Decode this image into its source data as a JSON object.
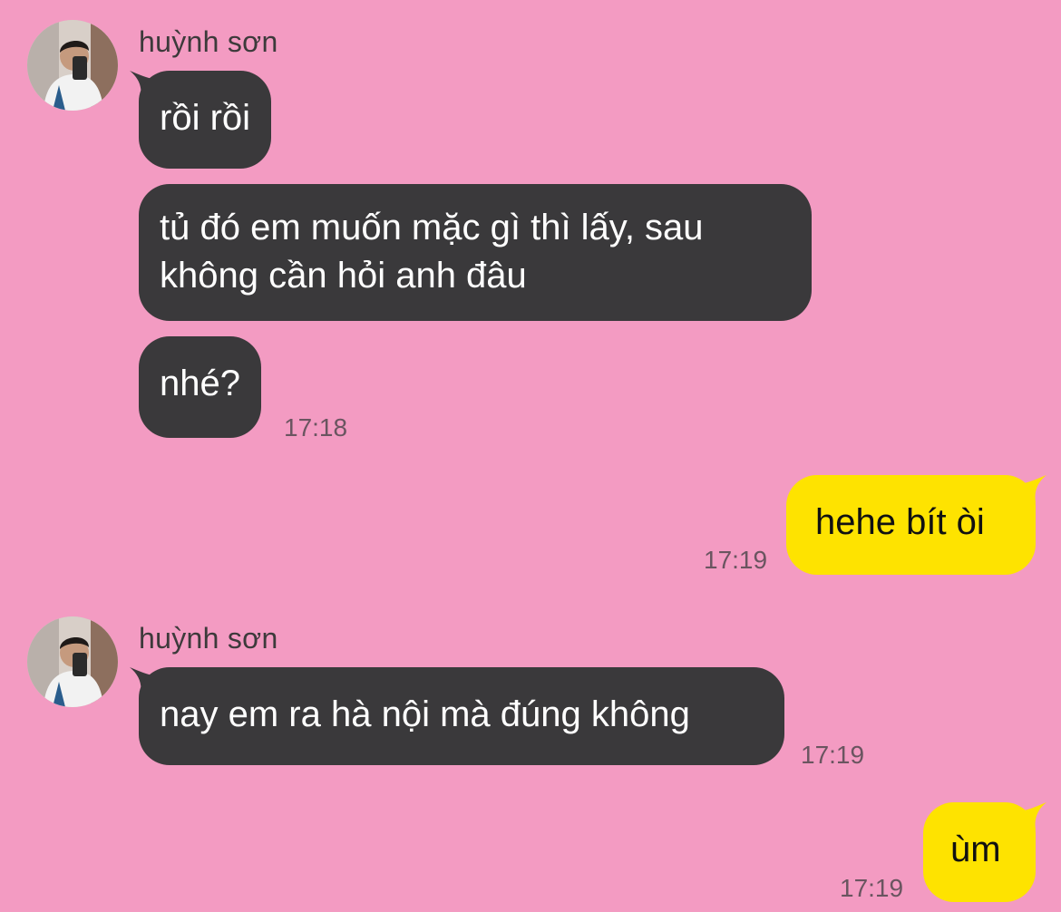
{
  "colors": {
    "background": "#f39bc2",
    "incoming_bubble": "#3a393b",
    "outgoing_bubble": "#fee300"
  },
  "messages": [
    {
      "sender": "huỳnh sơn",
      "avatar": "profile-photo",
      "bubbles": [
        "rồi rồi",
        "tủ đó em muốn mặc gì thì lấy, sau\nkhông cần hỏi anh đâu",
        "nhé?"
      ],
      "time": "17:18"
    },
    {
      "bubbles": [
        "hehe bít òi"
      ],
      "time": "17:19"
    },
    {
      "sender": "huỳnh sơn",
      "avatar": "profile-photo",
      "bubbles": [
        "nay em ra hà nội mà đúng không"
      ],
      "time": "17:19"
    },
    {
      "bubbles": [
        "ùm"
      ],
      "time": "17:19"
    }
  ]
}
